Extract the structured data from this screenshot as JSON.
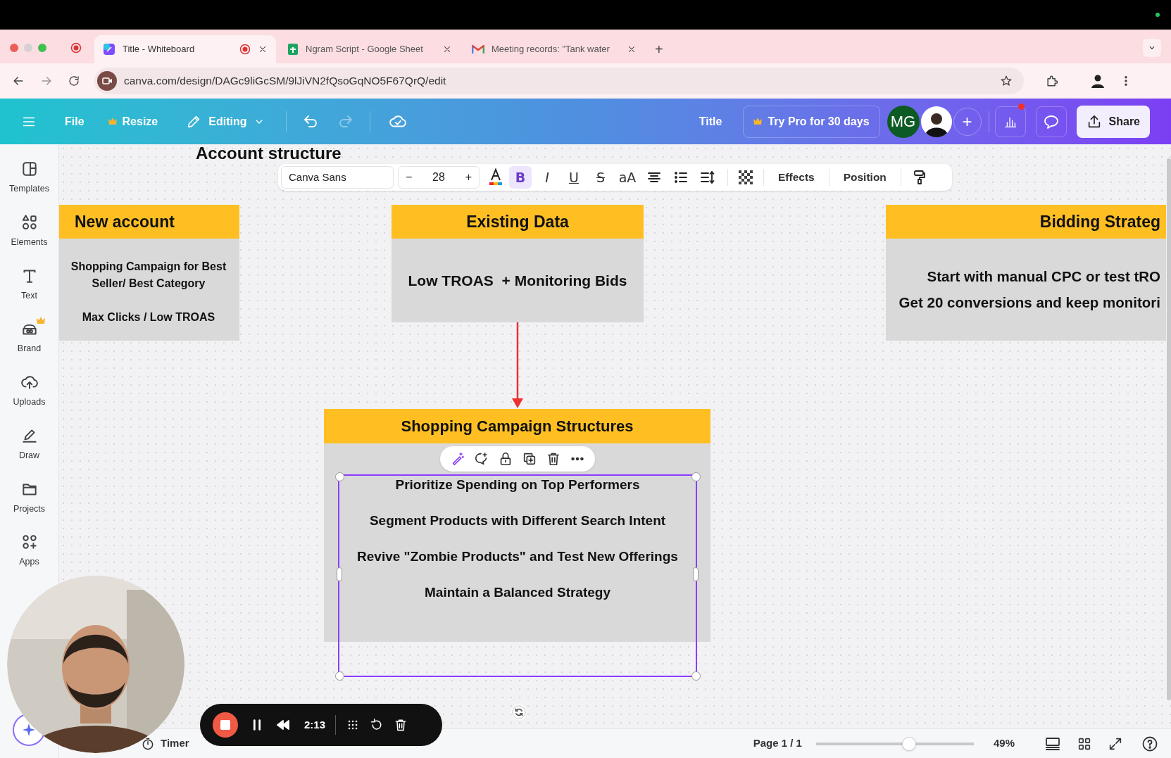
{
  "browser": {
    "tabs": [
      {
        "title": "Title - Whiteboard",
        "selected": true,
        "recording": true
      },
      {
        "title": "Ngram Script - Google Sheet",
        "selected": false,
        "recording": false
      },
      {
        "title": "Meeting records: \"Tank water",
        "selected": false,
        "recording": false
      }
    ],
    "new_tab": "+",
    "url": "canva.com/design/DAGc9liGcSM/9lJiVN2fQsoGqNO5F67QrQ/edit"
  },
  "editor_header": {
    "file": "File",
    "resize": "Resize",
    "mode": "Editing",
    "redo_disabled": true,
    "doc_title": "Title",
    "pro_button": "Try Pro for 30 days",
    "avatar_initials": "MG",
    "add": "+",
    "insights_notification": true,
    "share_button": "Share"
  },
  "sidebar": [
    {
      "label": "Templates"
    },
    {
      "label": "Elements"
    },
    {
      "label": "Text"
    },
    {
      "label": "Brand"
    },
    {
      "label": "Uploads"
    },
    {
      "label": "Draw"
    },
    {
      "label": "Projects"
    },
    {
      "label": "Apps"
    }
  ],
  "text_toolbar": {
    "font": "Canva Sans",
    "size_minus": "−",
    "size": "28",
    "size_plus": "+",
    "styles": [
      {
        "label": "B",
        "selected": true
      },
      {
        "label": "I",
        "selected": false
      },
      {
        "label": "U",
        "selected": false
      },
      {
        "label": "S",
        "selected": false
      },
      {
        "label": "aA",
        "selected": false
      }
    ],
    "buttons": [
      "Effects",
      "Position"
    ]
  },
  "canvas": {
    "title": "Account structure",
    "cards": [
      {
        "heading": "New account",
        "lines": [
          "Shopping Campaign for Best Seller/ Best Category",
          "Max Clicks / Low TROAS"
        ]
      },
      {
        "heading": "Existing Data",
        "lines": [
          "Low TROAS  + Monitoring Bids"
        ]
      },
      {
        "heading": "Bidding Strateg",
        "lines": [
          "Start with manual CPC or test tRO",
          "Get 20 conversions and keep monitori"
        ]
      }
    ],
    "main_card": {
      "heading": "Shopping Campaign Structures",
      "selected": true,
      "lines": [
        "Prioritize Spending on Top Performers",
        "Segment Products with Different Search Intent",
        "Revive \"Zombie Products\" and Test New Offerings",
        "Maintain a Balanced Strategy"
      ]
    }
  },
  "recorder": {
    "time": "2:13"
  },
  "status_bar": {
    "timer": "Timer",
    "page": "Page 1 / 1",
    "level": 0.59,
    "zoom": "49%"
  }
}
